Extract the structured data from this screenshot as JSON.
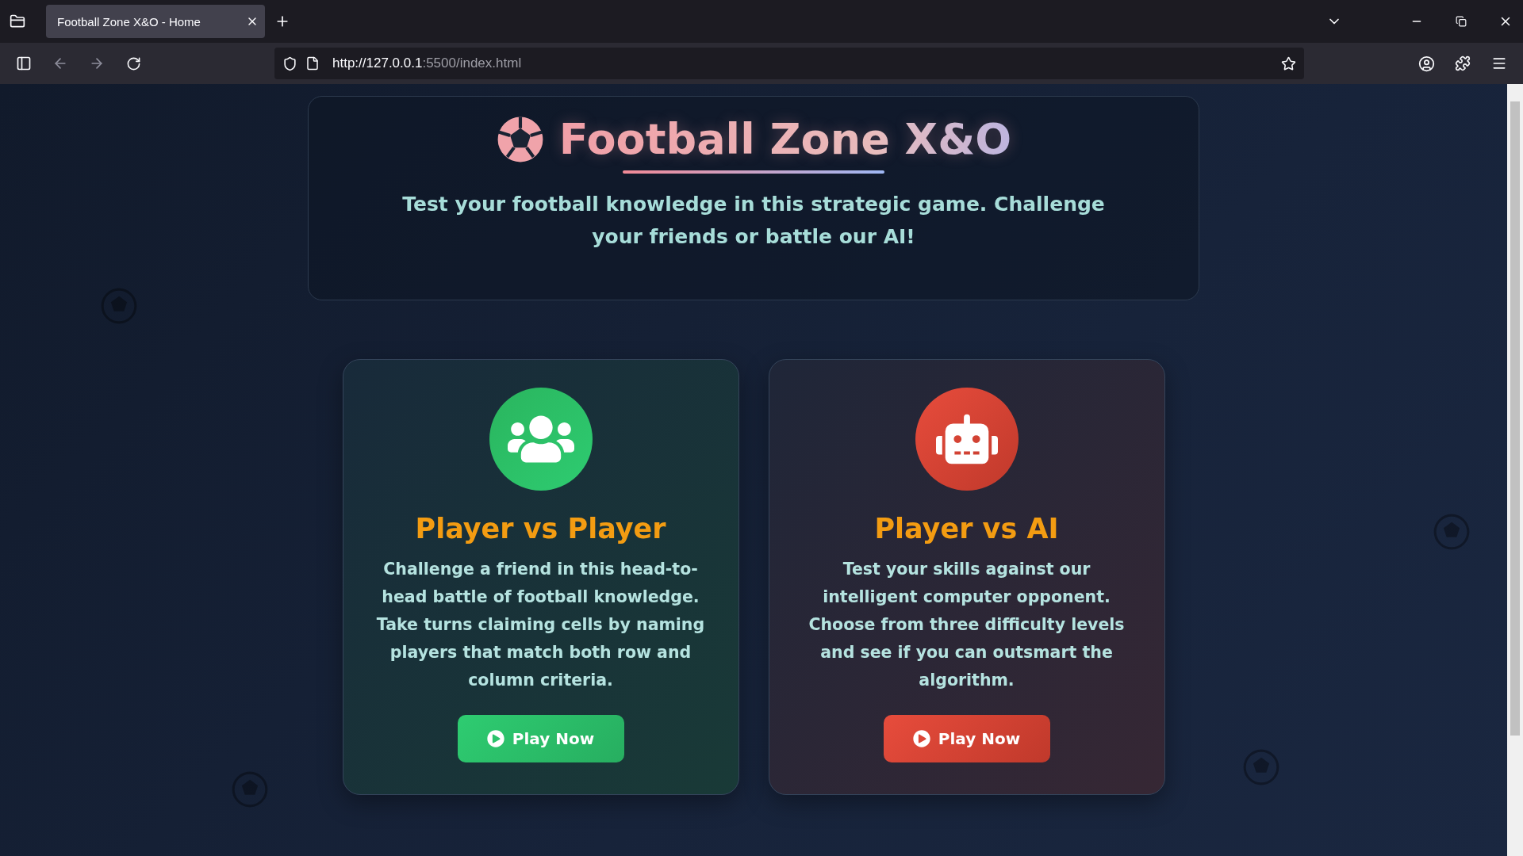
{
  "browser": {
    "tabs": [
      {
        "title": "Football Zone X&O - Home",
        "selected": true
      }
    ],
    "url_host": "http://127.0.0.1",
    "url_rest": ":5500/index.html"
  },
  "header": {
    "title": "Football Zone X&O",
    "subtitle": "Test your football knowledge in this strategic game. Challenge your friends or battle our AI!"
  },
  "modes": [
    {
      "kind": "pvp",
      "title": "Player vs Player",
      "description": "Challenge a friend in this head-to-head battle of football knowledge. Take turns claiming cells by naming players that match both row and column criteria.",
      "button": "Play Now"
    },
    {
      "kind": "ai",
      "title": "Player vs AI",
      "description": "Test your skills against our intelligent computer opponent. Choose from three difficulty levels and see if you can outsmart the algorithm.",
      "button": "Play Now"
    }
  ]
}
